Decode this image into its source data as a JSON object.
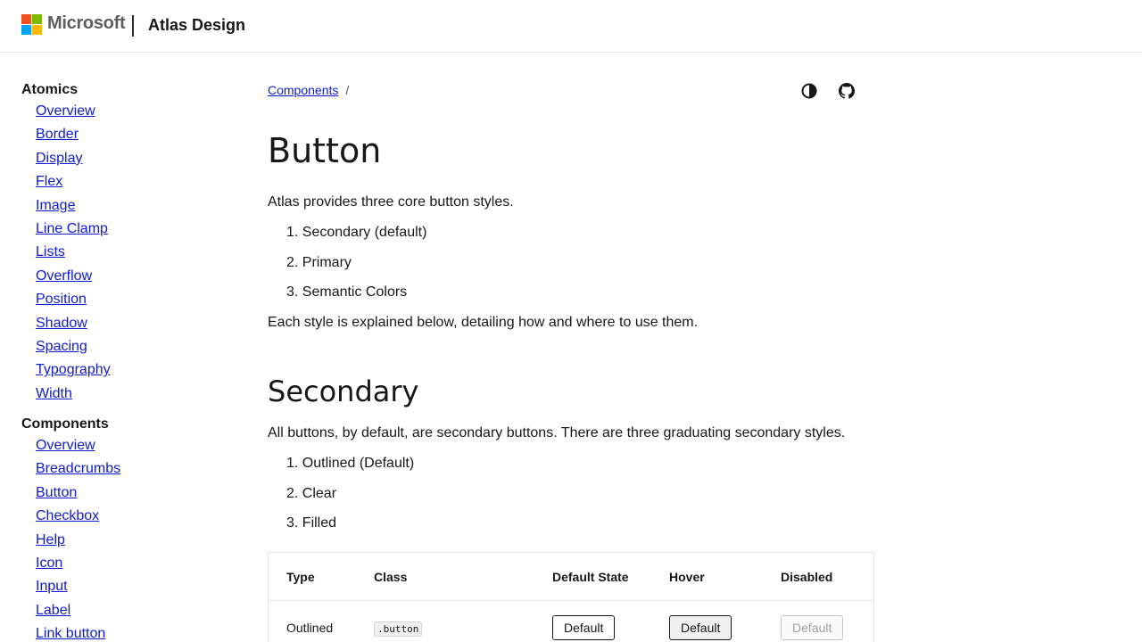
{
  "header": {
    "brand": "Microsoft",
    "site_title": "Atlas Design"
  },
  "sidebar": {
    "groups": [
      {
        "heading": "Atomics",
        "items": [
          "Overview",
          "Border",
          "Display",
          "Flex",
          "Image",
          "Line Clamp",
          "Lists",
          "Overflow",
          "Position",
          "Shadow",
          "Spacing",
          "Typography",
          "Width"
        ]
      },
      {
        "heading": "Components",
        "items": [
          "Overview",
          "Breadcrumbs",
          "Button",
          "Checkbox",
          "Help",
          "Icon",
          "Input",
          "Label",
          "Link button"
        ]
      }
    ]
  },
  "breadcrumb": {
    "link": "Components",
    "separator": "/"
  },
  "icons": {
    "theme": "theme-toggle-icon",
    "github": "github-icon"
  },
  "page": {
    "title": "Button",
    "intro": "Atlas provides three core button styles.",
    "styles": [
      "1. Secondary (default)",
      "2. Primary",
      "3. Semantic Colors"
    ],
    "after": "Each style is explained below, detailing how and where to use them."
  },
  "secondary": {
    "heading": "Secondary",
    "intro": "All buttons, by default, are secondary buttons. There are three graduating secondary styles.",
    "styles": [
      "1. Outlined (Default)",
      "2. Clear",
      "3. Filled"
    ]
  },
  "table": {
    "headers": [
      "Type",
      "Class",
      "Default State",
      "Hover",
      "Disabled"
    ],
    "rows": [
      {
        "type": "Outlined",
        "class": ".button",
        "default": "Default",
        "hover": "Default",
        "disabled": "Default"
      }
    ]
  },
  "colors": {
    "link": "#0f1bcf",
    "text": "#171717",
    "border": "#e3e3e3"
  }
}
